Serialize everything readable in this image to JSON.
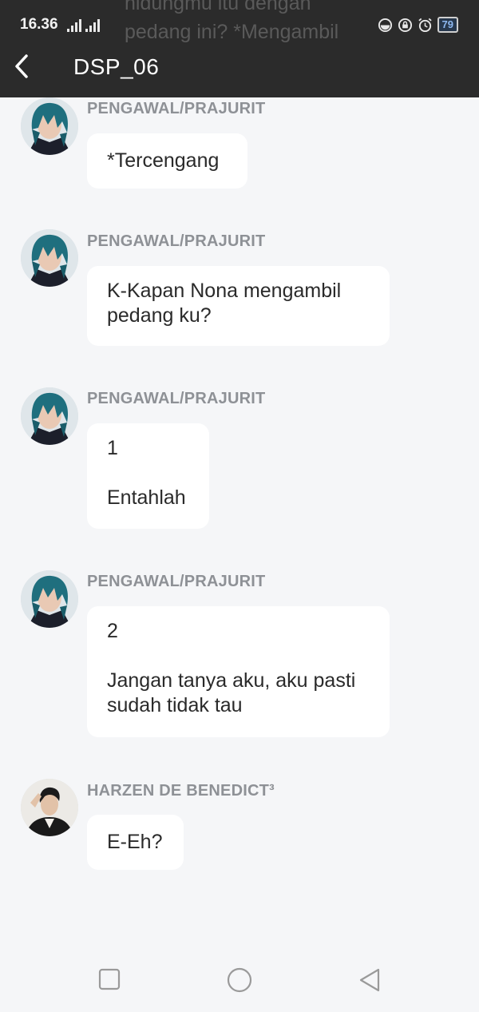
{
  "status_bar": {
    "time": "16.36",
    "battery": "79"
  },
  "header": {
    "title": "DSP_06",
    "overflow_text": "hidungmu itu dengan\npedang ini? *Mengambil"
  },
  "messages": [
    {
      "sender": "PENGAWAL/PRAJURIT",
      "text": "*Tercengang"
    },
    {
      "sender": "PENGAWAL/PRAJURIT",
      "text": "K-Kapan Nona mengambil\npedang ku?"
    },
    {
      "sender": "PENGAWAL/PRAJURIT",
      "text": "1\n\nEntahlah"
    },
    {
      "sender": "PENGAWAL/PRAJURIT",
      "text": "2\n\nJangan tanya aku, aku pasti\nsudah tidak tau"
    },
    {
      "sender": "HARZEN DE BENEDICT³",
      "text": "E-Eh?"
    }
  ],
  "colors": {
    "header_bg": "#2b2b2b",
    "chat_bg": "#f5f6f8",
    "bubble_bg": "#ffffff",
    "sender_text": "#8e9196"
  },
  "icons": {
    "back": "chevron-left-icon",
    "nav": [
      "recent-apps-icon",
      "home-icon",
      "back-triangle-icon"
    ]
  }
}
